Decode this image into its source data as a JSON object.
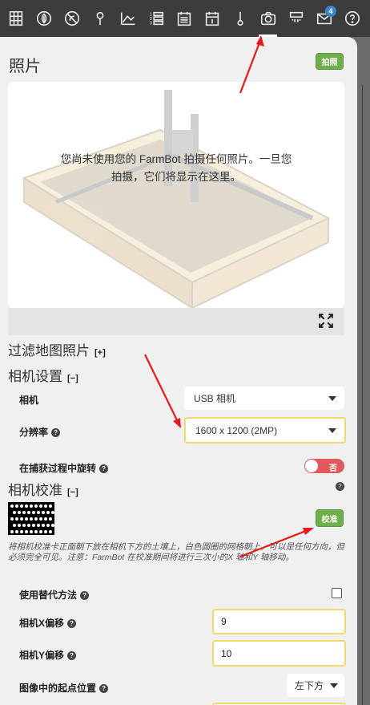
{
  "nav": {
    "icons": [
      "grid-icon",
      "plant-icon",
      "weed-icon",
      "pin-icon",
      "curve-icon",
      "sequence-icon",
      "regimen-icon",
      "event-icon",
      "thermometer-icon",
      "camera-icon",
      "farmbot-icon",
      "mail-icon",
      "help-icon"
    ],
    "mail_badge": "4",
    "active": "camera-icon"
  },
  "panel": {
    "title": "照片",
    "take_photo_label": "拍照",
    "empty_message": "您尚未使用您的 FarmBot 拍摄任何照片。一旦您拍摄，它们将显示在这里。"
  },
  "filter": {
    "title": "过滤地图照片",
    "toggle": "[+]"
  },
  "camera_settings": {
    "title": "相机设置",
    "toggle": "[−]",
    "camera_label": "相机",
    "camera_value": "USB 相机",
    "resolution_label": "分辨率",
    "resolution_value": "1600 x 1200 (2MP)",
    "rotate_label": "在捕获过程中旋转",
    "rotate_value": "否"
  },
  "calibration": {
    "title": "相机校准",
    "toggle": "[−]",
    "calibrate_label": "校准",
    "note": "将相机校准卡正面朝下放在相机下方的土壤上，白色圆圈的网格朝上。可以是任何方向，但必须完全可见。注意：FarmBot 在校准期间将进行三次小的X 轴和Y 轴移动。",
    "alt_method_label": "使用替代方法",
    "x_offset_label": "相机X偏移",
    "x_offset_value": "9",
    "y_offset_label": "相机Y偏移",
    "y_offset_value": "10",
    "origin_label": "图像中的起点位置",
    "origin_value": "左下方"
  },
  "colors": {
    "accent_green": "#6fae4a",
    "highlight": "#f5d76e",
    "toggle_off": "#e05a5a",
    "arrow": "#e8191c"
  }
}
